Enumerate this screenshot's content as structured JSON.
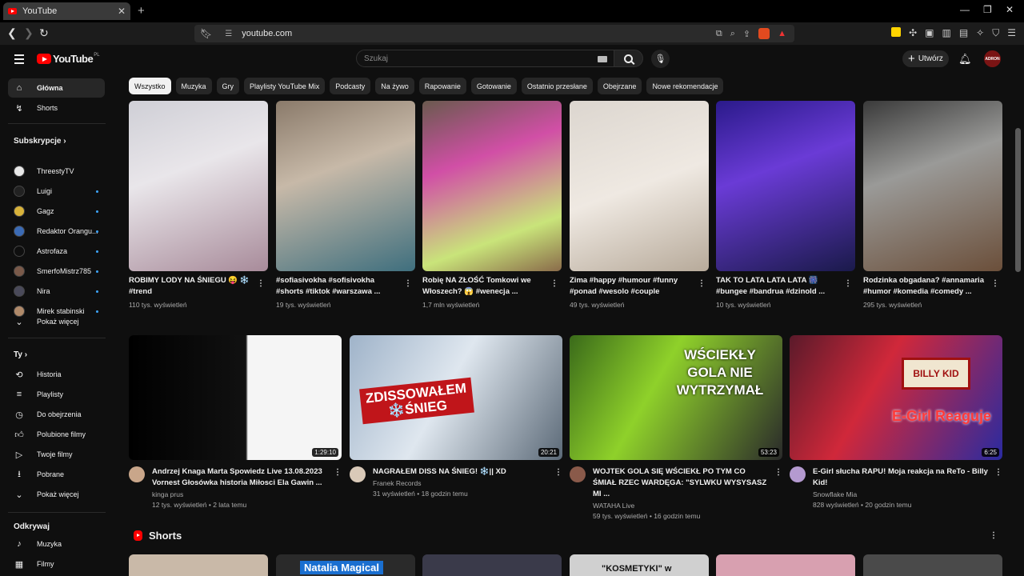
{
  "browser": {
    "tab_title": "YouTube",
    "url": "youtube.com"
  },
  "header": {
    "logo_text": "YouTube",
    "logo_country": "PL",
    "search_placeholder": "Szukaj",
    "create_label": "Utwórz",
    "avatar_text": "ADRON"
  },
  "sidebar": {
    "main": [
      {
        "label": "Główna",
        "icon": "home-icon"
      },
      {
        "label": "Shorts",
        "icon": "shorts-icon"
      }
    ],
    "subscriptions_title": "Subskrypcje",
    "subscriptions": [
      {
        "label": "ThreestyTV",
        "color": "#e8e8e8"
      },
      {
        "label": "Luigi",
        "color": "#222222"
      },
      {
        "label": "Gagz",
        "color": "#d8b23a"
      },
      {
        "label": "Redaktor Orangu...",
        "color": "#3b6bb5"
      },
      {
        "label": "Astrofaza",
        "color": "#0f0f0f"
      },
      {
        "label": "SmerfoMistrz785",
        "color": "#7a5a4a"
      },
      {
        "label": "Nira",
        "color": "#4a4a5a"
      },
      {
        "label": "Mirek stabinski",
        "color": "#b08a6a"
      }
    ],
    "show_more": "Pokaż więcej",
    "you_title": "Ty",
    "you_items": [
      {
        "label": "Historia",
        "icon": "history-icon"
      },
      {
        "label": "Playlisty",
        "icon": "playlist-icon"
      },
      {
        "label": "Do obejrzenia",
        "icon": "watch-later-icon"
      },
      {
        "label": "Polubione filmy",
        "icon": "like-icon"
      },
      {
        "label": "Twoje filmy",
        "icon": "your-videos-icon"
      },
      {
        "label": "Pobrane",
        "icon": "download-icon"
      },
      {
        "label": "Pokaż więcej",
        "icon": "chevron-down-icon"
      }
    ],
    "explore_title": "Odkrywaj",
    "explore_items": [
      {
        "label": "Muzyka",
        "icon": "music-icon"
      },
      {
        "label": "Filmy",
        "icon": "film-icon"
      }
    ]
  },
  "chips": [
    "Wszystko",
    "Muzyka",
    "Gry",
    "Playlisty YouTube Mix",
    "Podcasty",
    "Na żywo",
    "Rapowanie",
    "Gotowanie",
    "Ostatnio przesłane",
    "Obejrzane",
    "Nowe rekomendacje"
  ],
  "shorts_row": [
    {
      "title": "ROBIMY LODY NA ŚNIEGU 😝 ❄️ #trend",
      "views": "110 tys. wyświetleń",
      "bg": "linear-gradient(160deg,#cfcfd6,#e9e6ea 40%,#a88b9a)"
    },
    {
      "title": "#sofiasivokha #sofisivokha #shorts #tiktok #warszawa ...",
      "views": "19 tys. wyświetleń",
      "bg": "linear-gradient(160deg,#8a7a6a,#c7b9a8 40%,#3f6f7e)"
    },
    {
      "title": "Robię NA ZŁOŚĆ Tomkowi we Włoszech? 😱 #wenecja ...",
      "views": "1,7 mln wyświetleń",
      "bg": "linear-gradient(160deg,#6a5a4e,#d14fa6 35%,#c9e47a 75%,#8a6b4a)"
    },
    {
      "title": "Zima #happy #humour #funny #ponad #wesolo #couple #humor...",
      "views": "49 tys. wyświetleń",
      "bg": "linear-gradient(160deg,#dcd6cf,#efe9e2 50%,#b7aa9a)"
    },
    {
      "title": "TAK TO LATA LATA LATA 🎆 #bungee #bandrua #dzinold ...",
      "views": "10 tys. wyświetleń",
      "bg": "linear-gradient(160deg,#2a1a8a,#6a3bd6 40%,#1a1a4a)"
    },
    {
      "title": "Rodzinka obgadana? #annamaria #humor #komedia #comedy ...",
      "views": "295 tys. wyświetleń",
      "bg": "linear-gradient(160deg,#3a3a3a,#9a9a98 40%,#6b4f3a)"
    }
  ],
  "videos_row": [
    {
      "title": "Andrzej Knaga Marta  Spowiedz Live 13.08.2023 Vornest Głosówka historia Miłosci Ela Gawin ...",
      "channel": "kinga prus",
      "stats": "12 tys. wyświetleń • 2 lata temu",
      "duration": "1:29:10",
      "bg": "linear-gradient(90deg,#000 0%,#111 55%,#f5f5f5 56%,#f5f5f5 100%)",
      "avatar": "#c9a68a"
    },
    {
      "title": "NAGRAŁEM DISS NA ŚNIEG! ❄️|| XD",
      "channel": "Franek Records",
      "stats": "31 wyświetleń • 18 godzin temu",
      "duration": "20:21",
      "bg": "linear-gradient(120deg,#9fb3c9,#dfe7ef 45%,#5c6a78)",
      "avatar": "#d9c9b8"
    },
    {
      "title": "WOJTEK GOLA SIĘ WŚCIEKŁ PO TYM CO ŚMIAŁ RZEC WARDĘGA: \"SYLWKU WYSYSASZ MI ...",
      "channel": "WATAHA Live",
      "stats": "59 tys. wyświetleń • 16 godzin temu",
      "duration": "53:23",
      "bg": "linear-gradient(120deg,#3a6a1a,#8fd12a 40%,#2a2a2a)",
      "avatar": "#8a5a4a"
    },
    {
      "title": "E-Girl słucha RAPU! Moja reakcja na ReTo - Billy Kid!",
      "channel": "Snowflake Mia",
      "stats": "828 wyświetleń • 20 godzin temu",
      "duration": "6:25",
      "bg": "linear-gradient(120deg,#5a1a2a,#d0283a 40%,#2a2aa0)",
      "avatar": "#b49ad0"
    }
  ],
  "overlays": {
    "v2_text": "ZDISSOWAŁEM ❄️ŚNIEG",
    "v3_text": "WŚCIEKŁY GOLA NIE WYTRZYMAŁ",
    "v4_top": "BILLY KID",
    "v4_bottom": "E-Girl Reaguje"
  },
  "shorts_section_title": "Shorts",
  "bottom_thumbs": [
    {
      "text": "",
      "bg": "#c9b9a8"
    },
    {
      "text": "Natalia Magical",
      "bg": "#2a2a2a"
    },
    {
      "text": "",
      "bg": "#3a3a4a"
    },
    {
      "text": "\"KOSMETYKI\" w",
      "bg": "#d0d0d0"
    },
    {
      "text": "",
      "bg": "#d8a0b0"
    },
    {
      "text": "",
      "bg": "#4a4a4a"
    }
  ]
}
